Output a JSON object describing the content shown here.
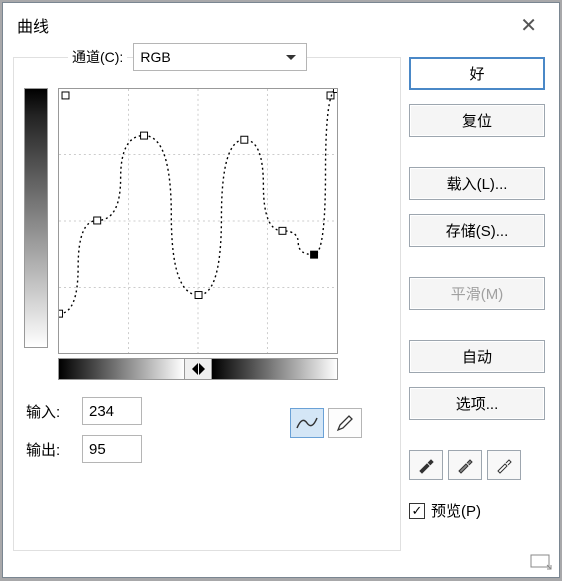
{
  "window": {
    "title": "曲线"
  },
  "channel": {
    "label": "通道(C):",
    "value": "RGB"
  },
  "io": {
    "input_label": "输入:",
    "input_value": "234",
    "output_label": "输出:",
    "output_value": "95"
  },
  "buttons": {
    "ok": "好",
    "reset": "复位",
    "load": "载入(L)...",
    "save": "存储(S)...",
    "smooth": "平滑(M)",
    "auto": "自动",
    "options": "选项..."
  },
  "preview": {
    "label": "预览(P)",
    "checked": true
  },
  "chart_data": {
    "type": "line",
    "title": "",
    "xlabel": "输入",
    "ylabel": "输出",
    "xlim": [
      0,
      255
    ],
    "ylim": [
      0,
      255
    ],
    "points": [
      {
        "x": 0,
        "y": 38
      },
      {
        "x": 35,
        "y": 128
      },
      {
        "x": 78,
        "y": 210
      },
      {
        "x": 128,
        "y": 56
      },
      {
        "x": 170,
        "y": 206
      },
      {
        "x": 205,
        "y": 118
      },
      {
        "x": 234,
        "y": 95
      },
      {
        "x": 255,
        "y": 255
      }
    ]
  },
  "colors": {
    "accent": "#4a88c7"
  }
}
